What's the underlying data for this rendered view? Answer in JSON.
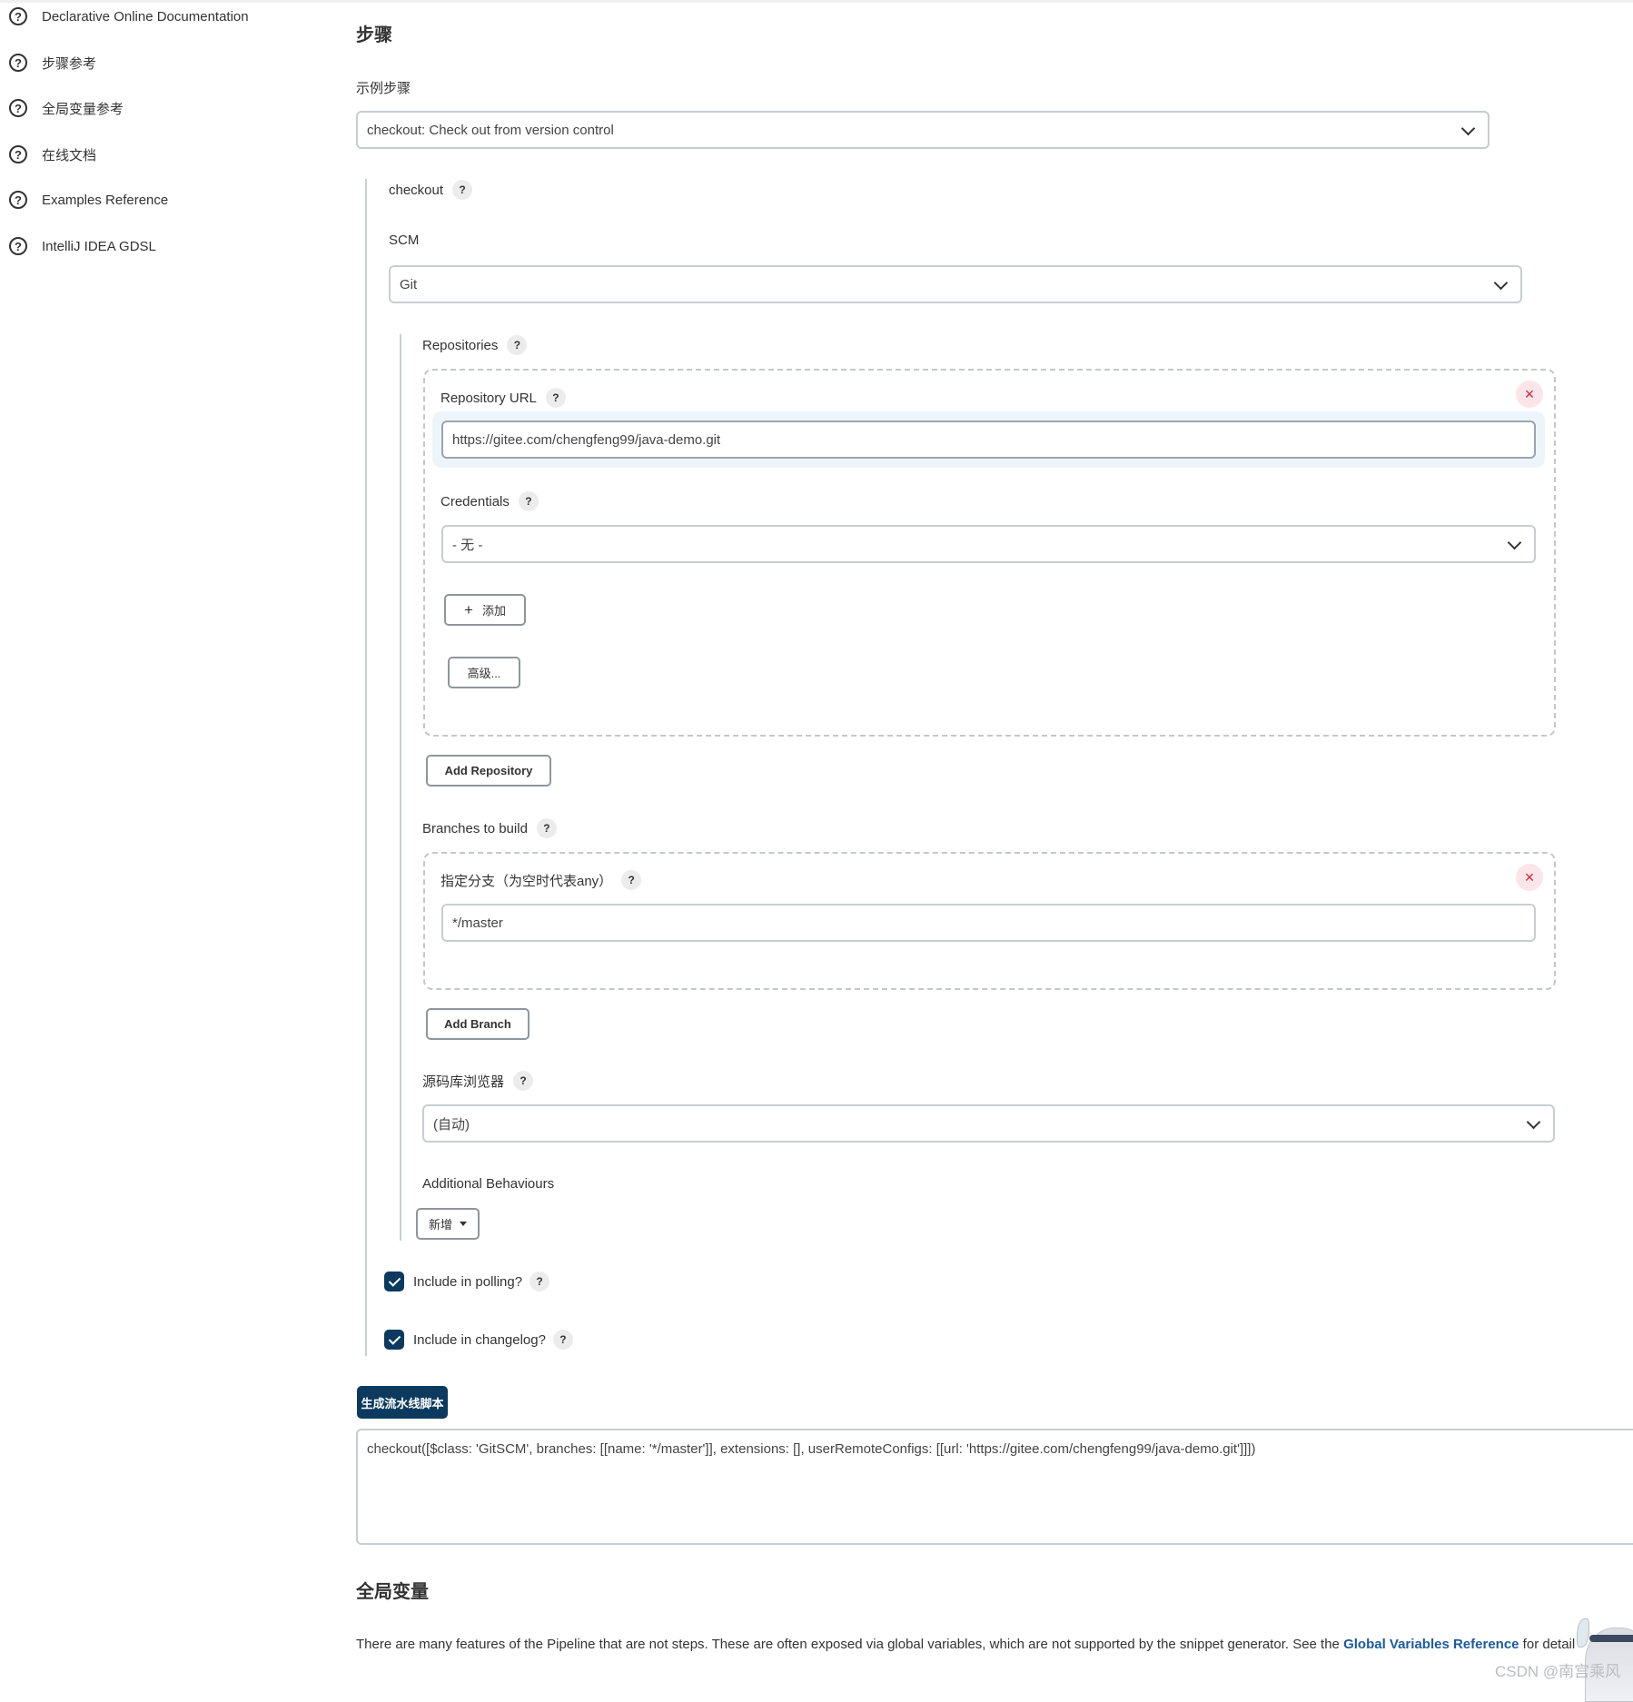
{
  "sidebar": {
    "items": [
      {
        "label": "Declarative Online Documentation",
        "icon": "help-circle-icon"
      },
      {
        "label": "步骤参考",
        "icon": "help-circle-icon"
      },
      {
        "label": "全局变量参考",
        "icon": "help-circle-icon"
      },
      {
        "label": "在线文档",
        "icon": "help-circle-icon"
      },
      {
        "label": "Examples Reference",
        "icon": "help-circle-icon"
      },
      {
        "label": "IntelliJ IDEA GDSL",
        "icon": "help-circle-icon"
      }
    ],
    "icon_glyph": "?"
  },
  "steps": {
    "title": "步骤",
    "sample_step_label": "示例步骤",
    "sample_step_value": "checkout: Check out from version control",
    "checkout_label": "checkout",
    "scm_label": "SCM",
    "scm_value": "Git",
    "repositories_label": "Repositories",
    "repository_url_label": "Repository URL",
    "repository_url_value": "https://gitee.com/chengfeng99/java-demo.git",
    "credentials_label": "Credentials",
    "credentials_value": "- 无 -",
    "add_credentials_label": "添加",
    "advanced_label": "高级...",
    "add_repository_label": "Add Repository",
    "branches_label": "Branches to build",
    "branch_specifier_label": "指定分支（为空时代表any）",
    "branch_specifier_value": "*/master",
    "add_branch_label": "Add Branch",
    "repo_browser_label": "源码库浏览器",
    "repo_browser_value": "(自动)",
    "additional_behaviours_label": "Additional Behaviours",
    "add_behaviour_label": "新增",
    "include_polling_label": "Include in polling?",
    "include_polling_checked": true,
    "include_changelog_label": "Include in changelog?",
    "include_changelog_checked": true,
    "help_glyph": "?",
    "remove_glyph": "×",
    "plus_glyph": "+"
  },
  "generator": {
    "button_label": "生成流水线脚本",
    "output": "checkout([$class: 'GitSCM', branches: [[name: '*/master']], extensions: [], userRemoteConfigs: [[url: 'https://gitee.com/chengfeng99/java-demo.git']]])"
  },
  "global_vars": {
    "title": "全局变量",
    "text_before": "There are many features of the Pipeline that are not steps. These are often exposed via global variables, which are not supported by the snippet generator. See the ",
    "link_text": "Global Variables Reference",
    "text_after": " for detail"
  },
  "watermark": "CSDN @南宫乘风",
  "colors": {
    "primary": "#0b3a5e",
    "link": "#1e5aa0",
    "remove": "#d0243c"
  }
}
